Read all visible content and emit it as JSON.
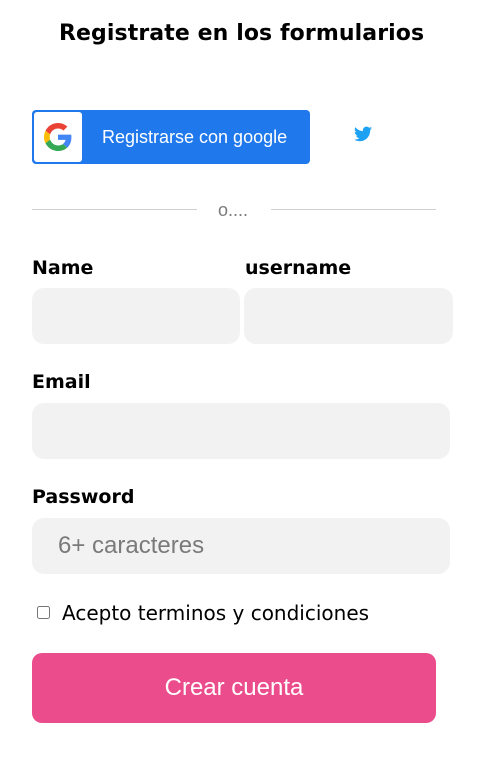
{
  "form": {
    "title": "Registrate en los formularios",
    "google_button_label": "Registrarse con google",
    "divider_text": "o....",
    "fields": {
      "name": {
        "label": "Name",
        "value": "",
        "placeholder": ""
      },
      "username": {
        "label": "username",
        "value": "",
        "placeholder": ""
      },
      "email": {
        "label": "Email",
        "value": "",
        "placeholder": ""
      },
      "password": {
        "label": "Password",
        "value": "",
        "placeholder": "6+ caracteres"
      }
    },
    "terms_label": "Acepto terminos y condiciones",
    "terms_checked": false,
    "submit_label": "Crear cuenta"
  },
  "icons": {
    "google": "google-icon",
    "twitter": "twitter-icon"
  },
  "colors": {
    "google_button": "#1f78ec",
    "submit_button": "#eb4c8b",
    "input_background": "#f2f2f2",
    "twitter": "#1da1f2"
  }
}
